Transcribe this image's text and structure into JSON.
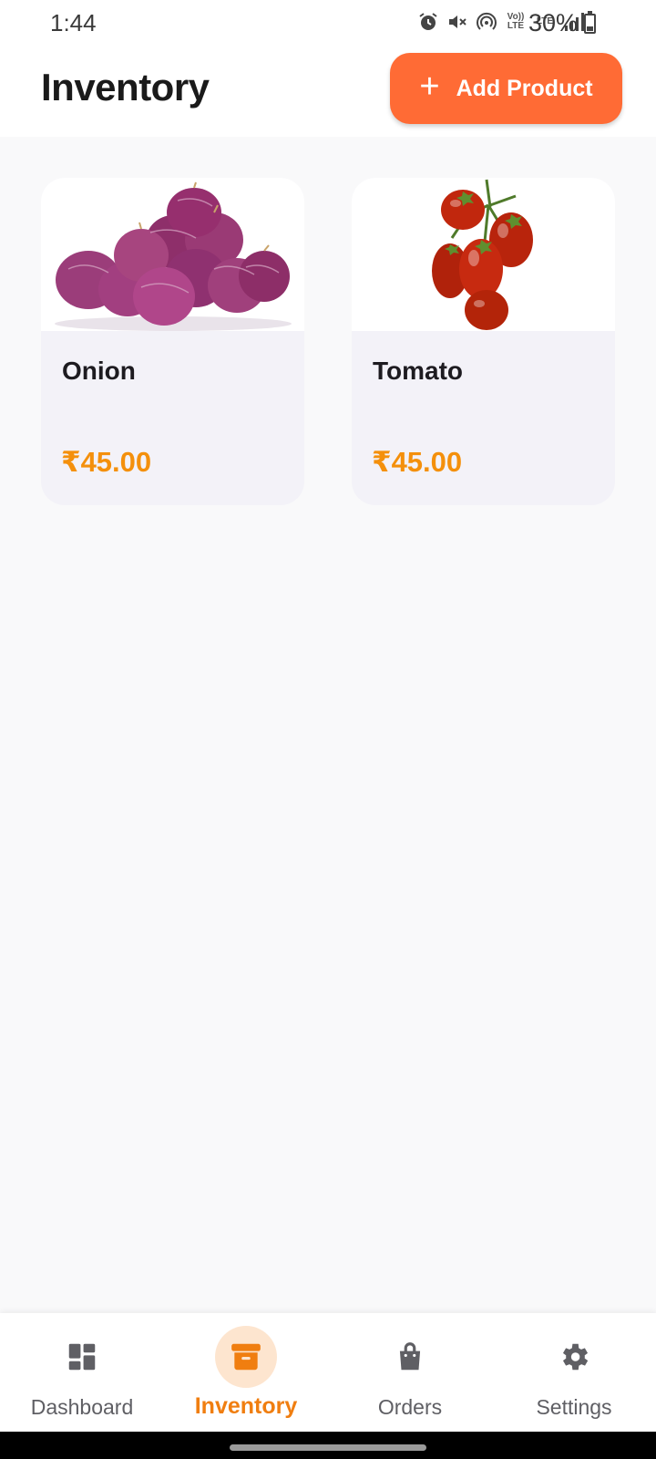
{
  "status_bar": {
    "time": "1:44",
    "icons": [
      "alarm-icon",
      "mute-icon",
      "hotspot-icon",
      "volte-icon",
      "lte-data-icon",
      "signal-icon"
    ],
    "volte_label": "Vo)) LTE",
    "lte_label": "LTE",
    "battery_percent": "30%",
    "battery_level": 0.3
  },
  "header": {
    "title": "Inventory",
    "add_button_icon": "+",
    "add_button_label": "Add Product",
    "accent_color": "#ff6b35"
  },
  "products": [
    {
      "name": "Onion",
      "price": "₹45.00",
      "image": "onion-image"
    },
    {
      "name": "Tomato",
      "price": "₹45.00",
      "image": "tomato-image"
    }
  ],
  "price_color": "#f4900c",
  "bottom_nav": {
    "items": [
      {
        "label": "Dashboard",
        "icon": "dashboard-icon",
        "active": false
      },
      {
        "label": "Inventory",
        "icon": "inventory-icon",
        "active": true
      },
      {
        "label": "Orders",
        "icon": "shopping-bag-icon",
        "active": false
      },
      {
        "label": "Settings",
        "icon": "gear-icon",
        "active": false
      }
    ],
    "active_color": "#f07e10"
  }
}
